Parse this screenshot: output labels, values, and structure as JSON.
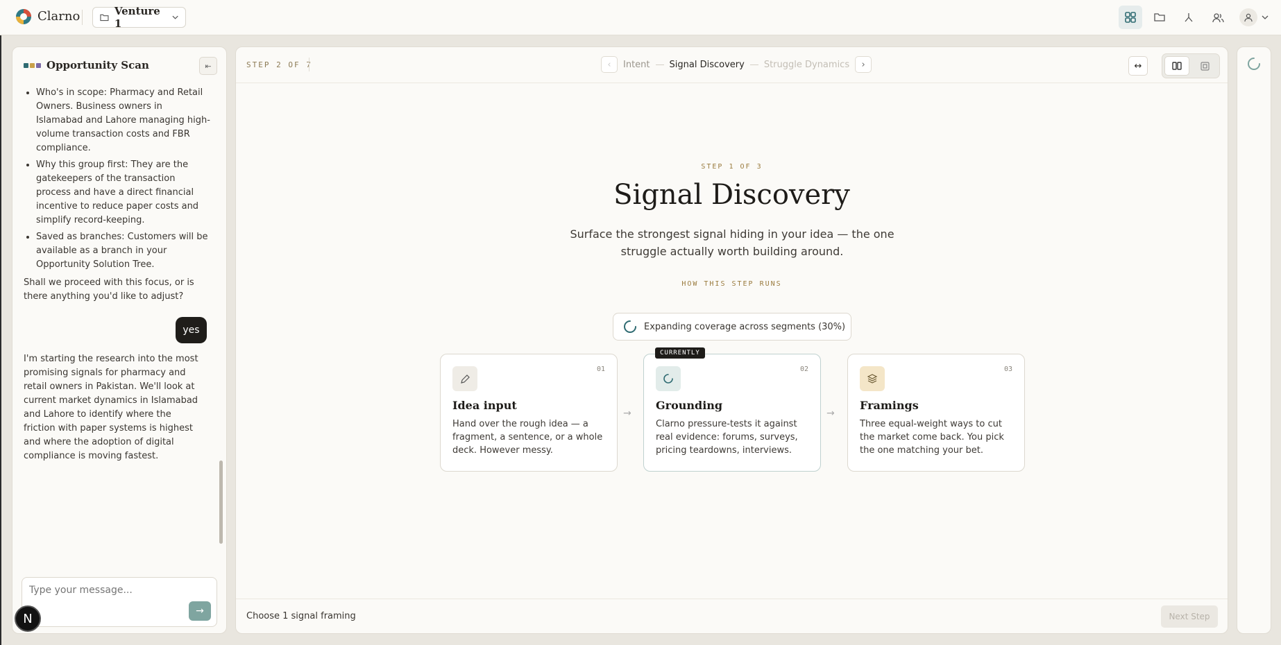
{
  "app": {
    "brand": "Clarno",
    "project": "Venture 1"
  },
  "topbar": {
    "icons": [
      "grid-icon",
      "folder-icon",
      "branch-icon",
      "users-icon",
      "user-icon",
      "chevron-down-icon"
    ]
  },
  "chat": {
    "title": "Opportunity Scan",
    "bullets": [
      "Who's in scope: Pharmacy and Retail Owners. Business owners in Islamabad and Lahore managing high-volume transaction costs and FBR compliance.",
      "Why this group first: They are the gatekeepers of the transaction process and have a direct financial incentive to reduce paper costs and simplify record-keeping.",
      "Saved as branches: Customers will be available as a branch in your Opportunity Solution Tree."
    ],
    "question": "Shall we proceed with this focus, or is there anything you'd like to adjust?",
    "user_message": "yes",
    "reply": "I'm starting the research into the most promising signals for pharmacy and retail owners in Pakistan. We'll look at current market dynamics in Islamabad and Lahore to identify where the friction with paper systems is highest and where the adoption of digital compliance is moving fastest.",
    "input_placeholder": "Type your message...",
    "badge": "N"
  },
  "main": {
    "step_label": "STEP 2 OF 7",
    "steps": {
      "prev": "Intent",
      "current": "Signal Discovery",
      "next": "Struggle Dynamics"
    },
    "eyebrow": "STEP 1 OF 3",
    "title": "Signal Discovery",
    "subtitle": "Surface the strongest signal hiding in your idea — the one struggle actually worth building around.",
    "how_label": "HOW THIS STEP RUNS",
    "progress_text": "Expanding coverage across segments (30%)",
    "progress_percent": 30,
    "current_tag": "CURRENTLY",
    "cards": [
      {
        "num": "01",
        "title": "Idea input",
        "desc": "Hand over the rough idea — a fragment, a sentence, or a whole deck. However messy."
      },
      {
        "num": "02",
        "title": "Grounding",
        "desc": "Clarno pressure-tests it against real evidence: forums, surveys, pricing teardowns, interviews."
      },
      {
        "num": "03",
        "title": "Framings",
        "desc": "Three equal-weight ways to cut the market come back. You pick the one matching your bet."
      }
    ],
    "footer_text": "Choose 1 signal framing",
    "next_button": "Next Step"
  },
  "colors": {
    "accent_teal": "#7fa5a0",
    "gold": "#9a7b3e",
    "dark": "#1e1c19"
  }
}
